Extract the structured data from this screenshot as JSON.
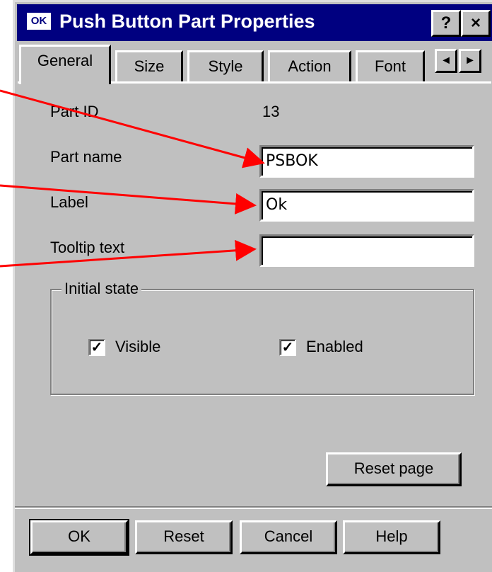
{
  "window": {
    "title": "Push Button Part Properties",
    "system_icon": "OK",
    "help_button": "?",
    "close_button": "×"
  },
  "tabs": [
    {
      "label": "General",
      "active": true
    },
    {
      "label": "Size",
      "active": false
    },
    {
      "label": "Style",
      "active": false
    },
    {
      "label": "Action",
      "active": false
    },
    {
      "label": "Font",
      "active": false
    }
  ],
  "tab_scroll": {
    "left": "◄",
    "right": "►"
  },
  "general": {
    "part_id_label": "Part ID",
    "part_id_value": "13",
    "part_name_label": "Part name",
    "part_name_value": "PSBOK",
    "label_label": "Label",
    "label_value": "Ok",
    "tooltip_label": "Tooltip text",
    "tooltip_value": ""
  },
  "initial_state": {
    "legend": "Initial state",
    "visible_label": "Visible",
    "visible_checked": true,
    "enabled_label": "Enabled",
    "enabled_checked": true,
    "check_mark": "✓"
  },
  "buttons": {
    "reset_page": "Reset page",
    "ok": "OK",
    "reset": "Reset",
    "cancel": "Cancel",
    "help": "Help"
  },
  "colors": {
    "titlebar": "#000080",
    "face": "#c0c0c0",
    "annotation_arrow": "#ff0000"
  }
}
